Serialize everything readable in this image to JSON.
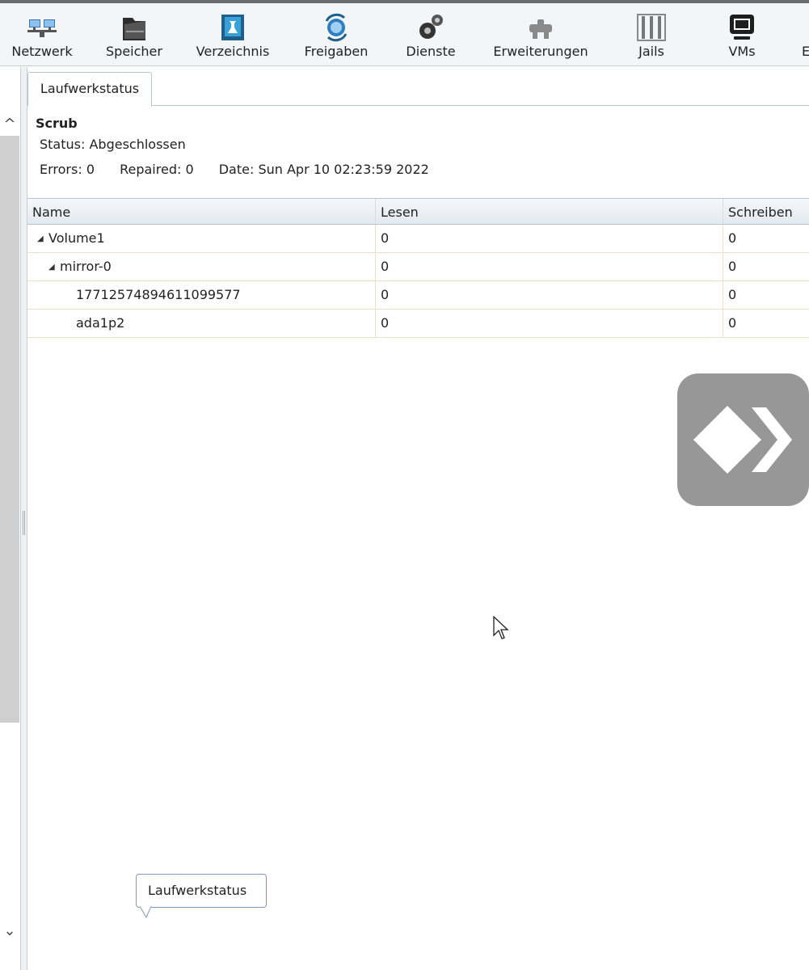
{
  "toolbar": {
    "items": [
      {
        "label": "Netzwerk",
        "icon": "network-icon"
      },
      {
        "label": "Speicher",
        "icon": "storage-icon"
      },
      {
        "label": "Verzeichnis",
        "icon": "directory-icon"
      },
      {
        "label": "Freigaben",
        "icon": "sharing-icon"
      },
      {
        "label": "Dienste",
        "icon": "services-icon"
      },
      {
        "label": "Erweiterungen",
        "icon": "plugins-icon"
      },
      {
        "label": "Jails",
        "icon": "jails-icon"
      },
      {
        "label": "VMs",
        "icon": "vms-icon"
      },
      {
        "label": "E",
        "icon": "more-icon"
      }
    ]
  },
  "left_panel": {
    "up_arrow": "^",
    "down_arrow": "⌄"
  },
  "main": {
    "tab_label": "Laufwerkstatus",
    "scrub": {
      "title": "Scrub",
      "status": "Status: Abgeschlossen",
      "errors": "Errors: 0",
      "repaired": "Repaired: 0",
      "date": "Date: Sun Apr 10 02:23:59 2022"
    },
    "grid": {
      "headers": {
        "name": "Name",
        "read": "Lesen",
        "write": "Schreiben"
      },
      "rows": [
        {
          "name": "Volume1",
          "read": "0",
          "write": "0",
          "toggle": "◢"
        },
        {
          "name": "mirror-0",
          "read": "0",
          "write": "0",
          "toggle": "◢"
        },
        {
          "name": "17712574894611099577",
          "read": "0",
          "write": "0",
          "toggle": ""
        },
        {
          "name": "ada1p2",
          "read": "0",
          "write": "0",
          "toggle": ""
        }
      ]
    }
  },
  "tooltip": {
    "text": "Laufwerkstatus"
  },
  "colors": {
    "overlay_badge": "#979797",
    "toolbar_bg": "#f4f5f6",
    "grid_border": "#eadfc8"
  }
}
